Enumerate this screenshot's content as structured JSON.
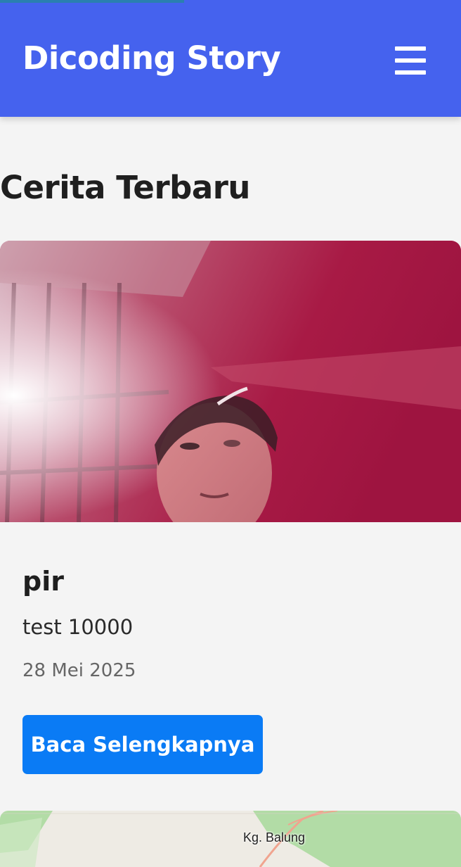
{
  "app": {
    "title": "Dicoding Story",
    "menu_icon": "hamburger-icon",
    "colors": {
      "header": "#4562ee",
      "button": "#0a7bf5",
      "background": "#f4f4f4"
    }
  },
  "page": {
    "section_title": "Cerita Terbaru"
  },
  "stories": [
    {
      "name": "pir",
      "description": "test 10000",
      "date": "28 Mei 2025",
      "button_label": "Baca Selengkapnya"
    }
  ],
  "map": {
    "label": "Kg. Balung"
  }
}
